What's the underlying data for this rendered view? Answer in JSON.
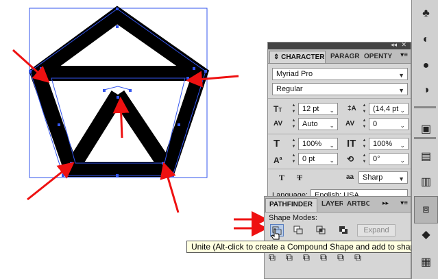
{
  "character_panel": {
    "tabs": [
      {
        "label": "CHARACTER",
        "active": true
      },
      {
        "label": "PARAGR",
        "active": false
      },
      {
        "label": "OPENTY",
        "active": false
      }
    ],
    "font_family": "Myriad Pro",
    "font_style": "Regular",
    "font_size": "12 pt",
    "leading": "(14,4 pt",
    "kerning": "Auto",
    "tracking": "0",
    "horizontal_scale": "100%",
    "vertical_scale": "100%",
    "baseline_shift": "0 pt",
    "rotation": "0°",
    "antialiasing": "Sharp",
    "language_label": "Language:",
    "language_value": "English: USA"
  },
  "pathfinder_panel": {
    "tabs": [
      {
        "label": "PATHFINDER",
        "active": true
      },
      {
        "label": "LAYER",
        "active": false
      },
      {
        "label": "ARTBO",
        "active": false
      }
    ],
    "shape_modes_label": "Shape Modes:",
    "expand_label": "Expand"
  },
  "tooltip": "Unite (Alt-click to create a Compound Shape and add to shape area)",
  "tools": [
    "club-icon",
    "contrast-icon",
    "sphere-icon",
    "gradient-icon",
    "brush-icon",
    "table-icon",
    "layers-icon",
    "stack-icon"
  ],
  "colors": {
    "selection": "#2255ee",
    "arrow": "#ee1111",
    "shape": "#000000"
  }
}
